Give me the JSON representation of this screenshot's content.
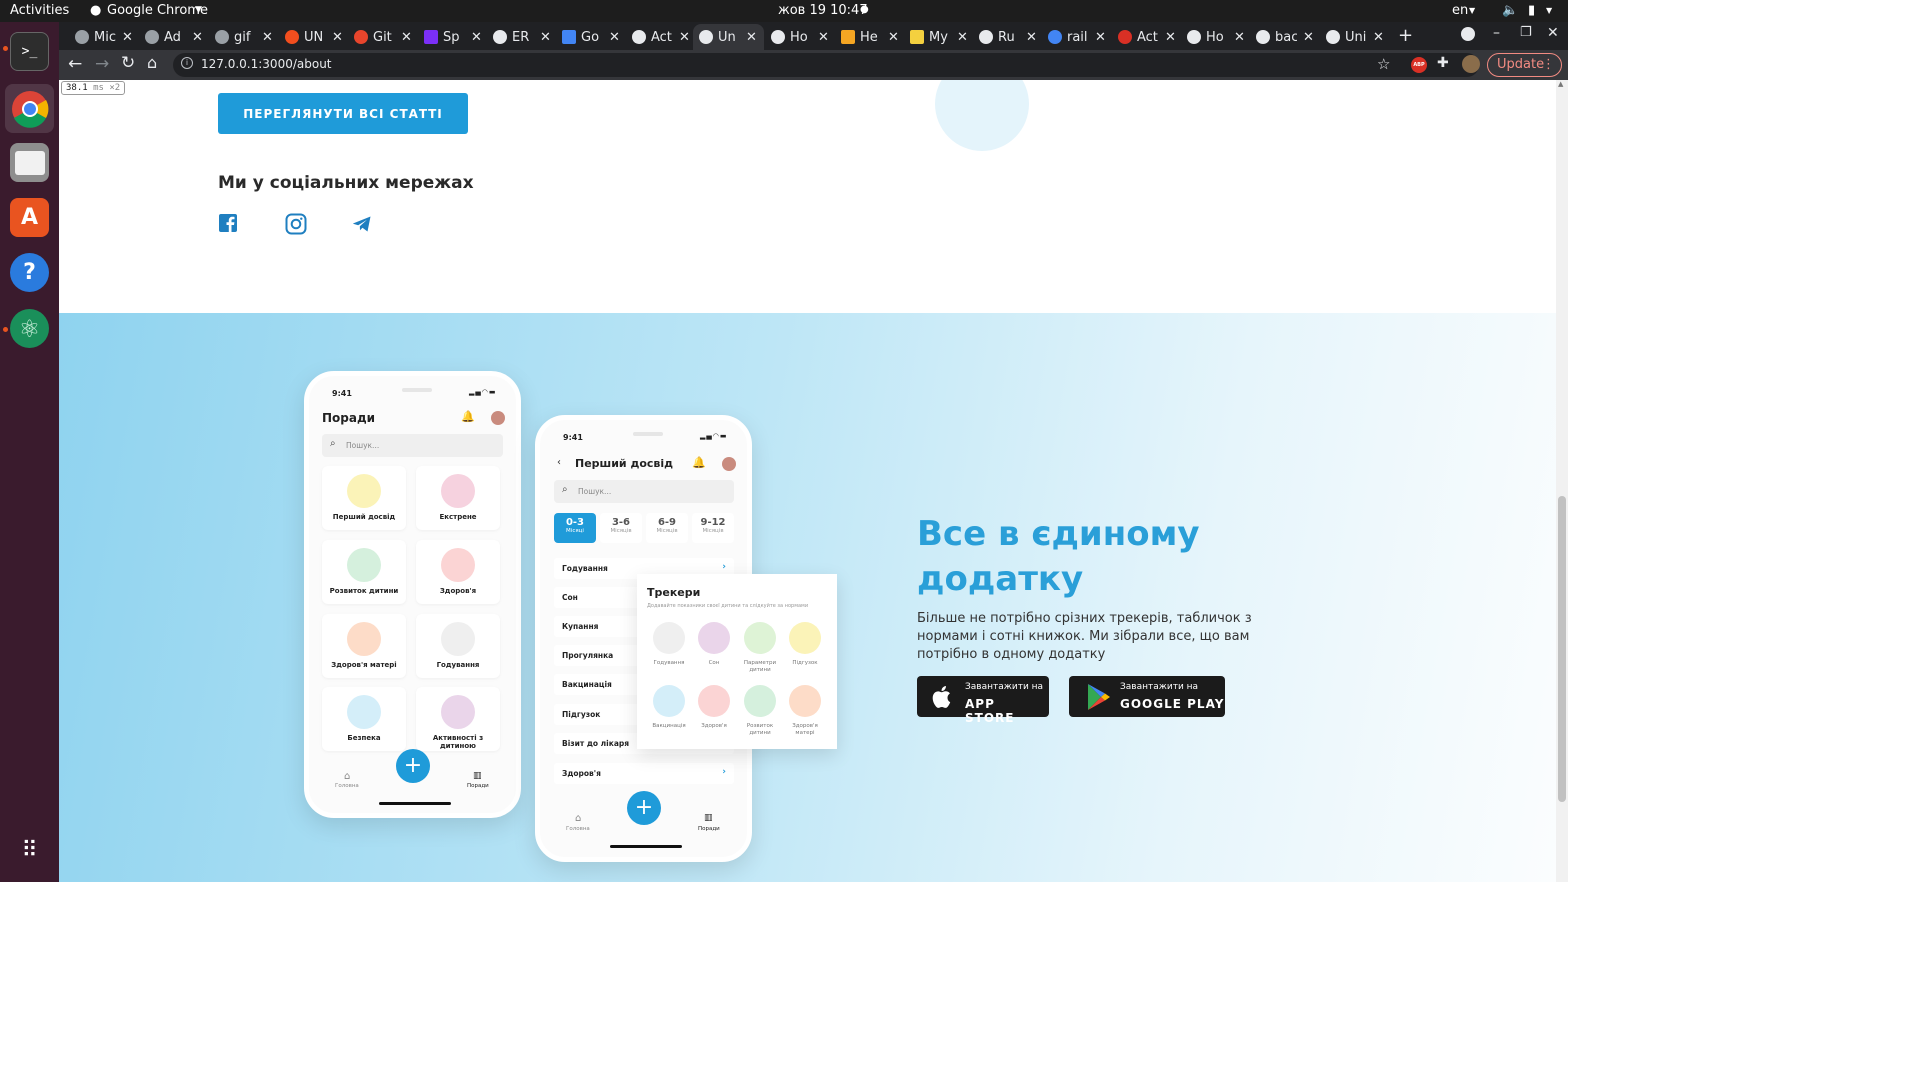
{
  "os": {
    "activities": "Activities",
    "app_name": "Google Chrome",
    "datetime": "жов 19  10:47",
    "lang": "en"
  },
  "tabs": [
    {
      "label": "Mic",
      "icon_color": "#9aa0a6"
    },
    {
      "label": "Ad",
      "icon_color": "#9aa0a6"
    },
    {
      "label": "gif",
      "icon_color": "#9aa0a6"
    },
    {
      "label": "UN",
      "icon_color": "#f24e1e"
    },
    {
      "label": "Git",
      "icon_color": "#e8452c"
    },
    {
      "label": "Sp",
      "icon_color": "#7b2ff7"
    },
    {
      "label": "ER",
      "icon_color": "#e8eaed"
    },
    {
      "label": "Go",
      "icon_color": "#4285f4"
    },
    {
      "label": "Act",
      "icon_color": "#e8eaed"
    },
    {
      "label": "Un",
      "icon_color": "#e8eaed"
    },
    {
      "label": "Ho",
      "icon_color": "#e8eaed"
    },
    {
      "label": "He",
      "icon_color": "#f5a623"
    },
    {
      "label": "My",
      "icon_color": "#f4d03f"
    },
    {
      "label": "Ru",
      "icon_color": "#e8eaed"
    },
    {
      "label": "rail",
      "icon_color": "#4285f4"
    },
    {
      "label": "Act",
      "icon_color": "#d93025"
    },
    {
      "label": "Ho",
      "icon_color": "#e8eaed"
    },
    {
      "label": "bac",
      "icon_color": "#e8eaed"
    },
    {
      "label": "Uni",
      "icon_color": "#e8eaed"
    }
  ],
  "browser": {
    "url": "127.0.0.1:3000/about",
    "update_label": "Update",
    "perf_badge": "38.1",
    "perf_unit": "ms ×2"
  },
  "page": {
    "cta_label": "ПЕРЕГЛЯНУТИ ВСІ СТАТТІ",
    "social_title": "Ми у соціальних мережах",
    "app_title": "Все в єдиному додатку",
    "app_desc": "Більше не потрібно срізних трекерів, табличок з нормами і сотні книжок. Ми зібрали все, що вам потрібно в одному додатку",
    "appstore_small": "Завантажити на",
    "appstore_big": "APP STORE",
    "gplay_small": "Завантажити на",
    "gplay_big": "GOOGLE PLAY"
  },
  "phone1": {
    "time": "9:41",
    "title": "Поради",
    "search": "Пошук...",
    "cards": [
      {
        "label": "Перший досвід",
        "color": "#fbf3b8"
      },
      {
        "label": "Екстрене",
        "color": "#f6d2df"
      },
      {
        "label": "Розвиток дитини",
        "color": "#d5f0dd"
      },
      {
        "label": "Здоров'я",
        "color": "#fbd4d4"
      },
      {
        "label": "Здоров'я матері",
        "color": "#fddcc8"
      },
      {
        "label": "Годування",
        "color": "#efefef"
      },
      {
        "label": "Безпека",
        "color": "#d4eef9"
      },
      {
        "label": "Активності з дитиною",
        "color": "#ead5ea"
      }
    ],
    "nav_home": "Головна",
    "nav_tips": "Поради"
  },
  "phone2": {
    "time": "9:41",
    "title": "Перший досвід",
    "search": "Пошук...",
    "ages": [
      {
        "num": "0-3",
        "sub": "Місяці"
      },
      {
        "num": "3-6",
        "sub": "Місяців"
      },
      {
        "num": "6-9",
        "sub": "Місяців"
      },
      {
        "num": "9-12",
        "sub": "Місяців"
      }
    ],
    "rows": [
      "Годування",
      "Сон",
      "Купання",
      "Прогулянка",
      "Вакцинація",
      "Підгузок",
      "Візит до лікаря",
      "Здоров'я"
    ],
    "nav_home": "Головна",
    "nav_tips": "Поради"
  },
  "trackers": {
    "title": "Трекери",
    "subtitle": "Додавайте показники своєї дитини та слідкуйте за нормами",
    "items": [
      {
        "label": "Годування",
        "color": "#efefef"
      },
      {
        "label": "Сон",
        "color": "#ead5ea"
      },
      {
        "label": "Параметри дитини",
        "color": "#def3d6"
      },
      {
        "label": "Підгузок",
        "color": "#fbf3b8"
      },
      {
        "label": "Вакцинація",
        "color": "#d4eef9"
      },
      {
        "label": "Здоров'я",
        "color": "#fbd4d4"
      },
      {
        "label": "Розвиток дитини",
        "color": "#d5f0dd"
      },
      {
        "label": "Здоров'я матері",
        "color": "#fddcc8"
      }
    ]
  }
}
